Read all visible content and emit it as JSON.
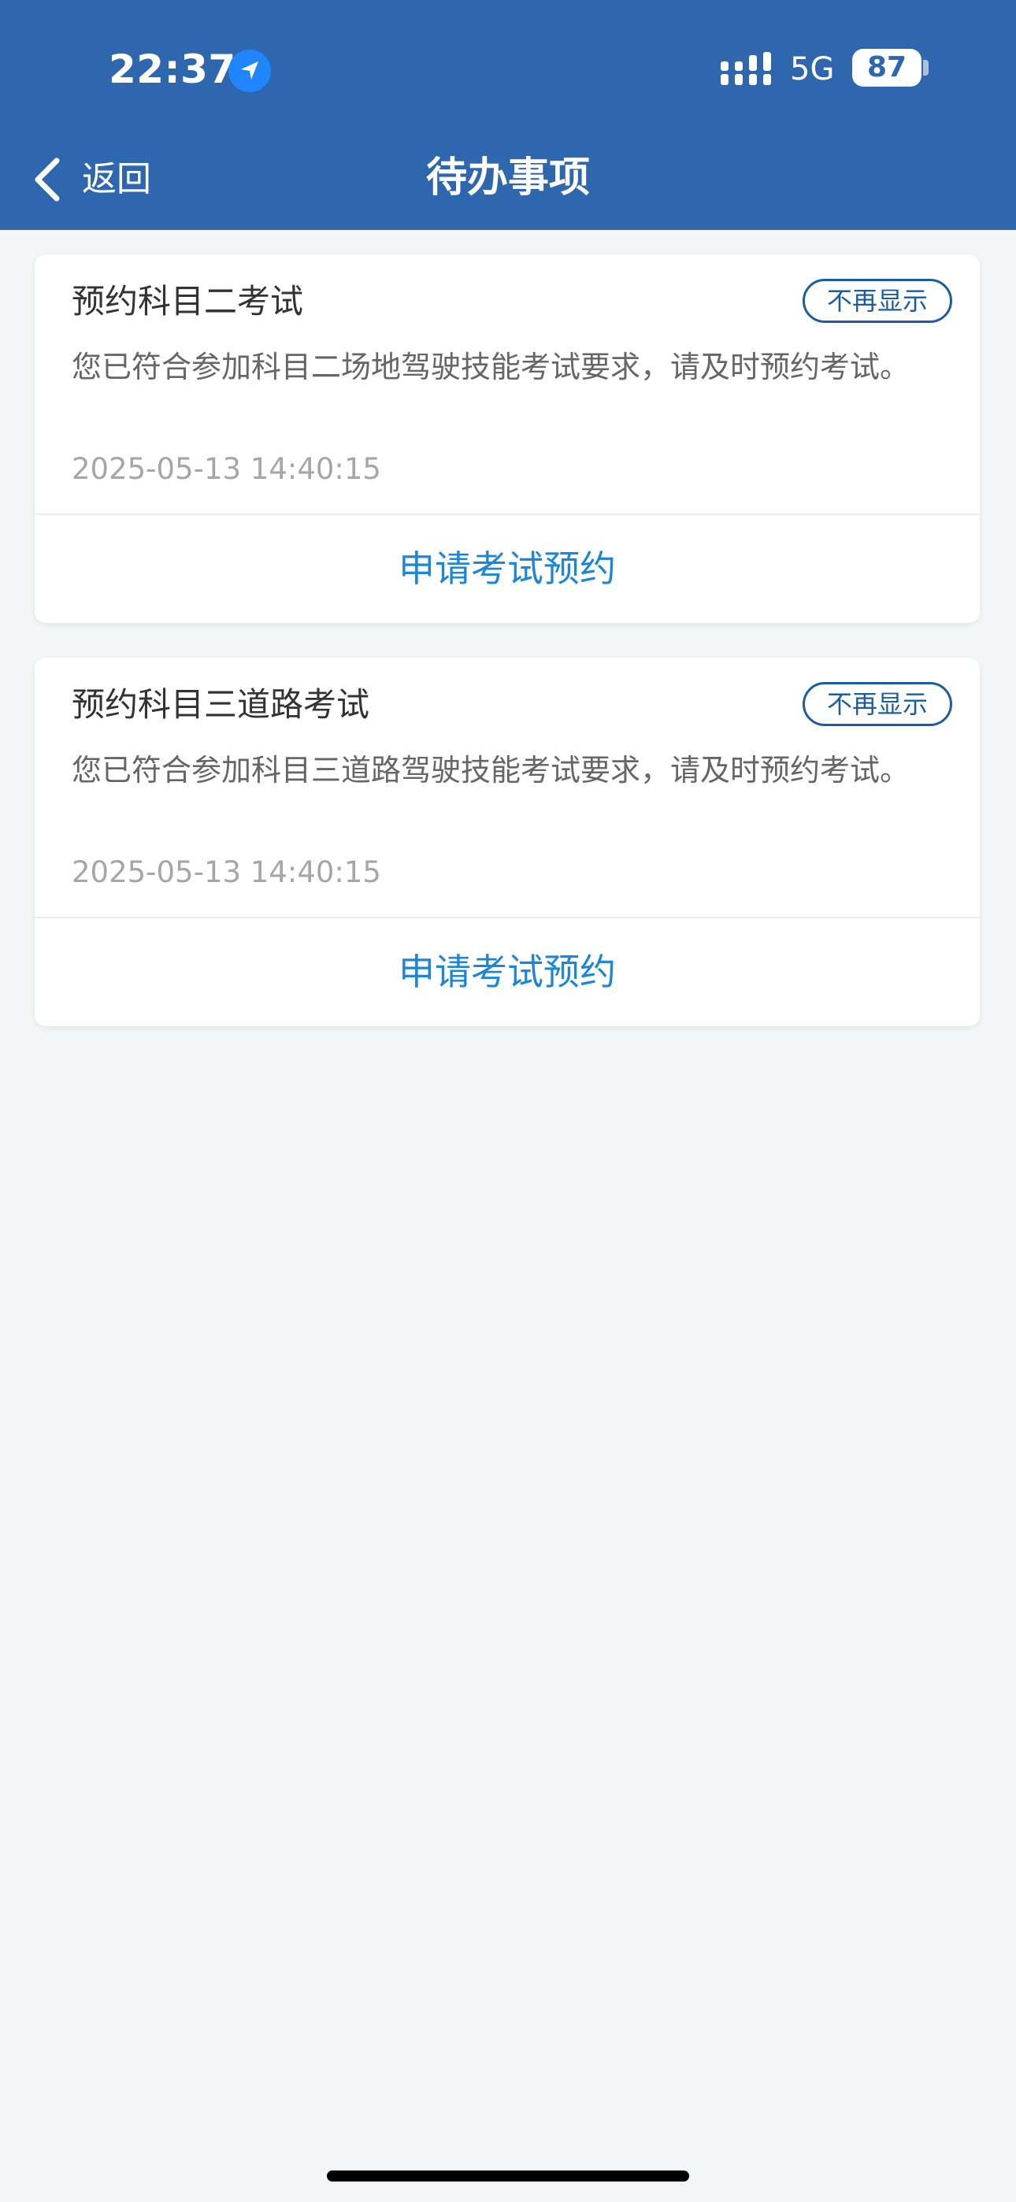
{
  "status_bar": {
    "time": "22:37",
    "network": "5G",
    "battery": "87"
  },
  "header": {
    "back_label": "返回",
    "title": "待办事项"
  },
  "todos": [
    {
      "title": "预约科目二考试",
      "dismiss_label": "不再显示",
      "description": "您已符合参加科目二场地驾驶技能考试要求，请及时预约考试。",
      "timestamp": "2025-05-13 14:40:15",
      "action_label": "申请考试预约"
    },
    {
      "title": "预约科目三道路考试",
      "dismiss_label": "不再显示",
      "description": "您已符合参加科目三道路驾驶技能考试要求，请及时预约考试。",
      "timestamp": "2025-05-13 14:40:15",
      "action_label": "申请考试预约"
    }
  ],
  "colors": {
    "header_bg": "#2e67ad",
    "page_bg": "#f3f6f7",
    "action_text": "#1d86d9",
    "dismiss_border": "#1d5d9e"
  }
}
